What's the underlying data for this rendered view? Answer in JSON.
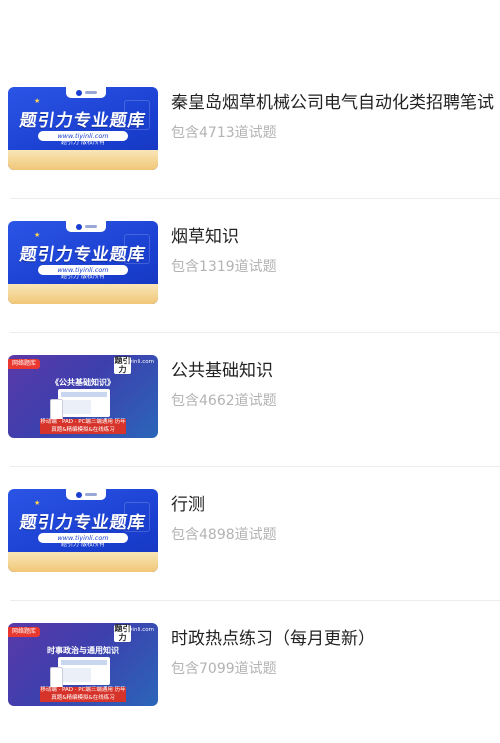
{
  "items": [
    {
      "title": "秦皇岛烟草机械公司电气自动化类招聘笔试",
      "count": "包含4713道试题",
      "thumb": {
        "style": "blue",
        "headline": "题引力专业题库",
        "url": "www.tiyinli.com",
        "footer": "题引力 版权所有"
      }
    },
    {
      "title": "烟草知识",
      "count": "包含1319道试题",
      "thumb": {
        "style": "blue",
        "headline": "题引力专业题库",
        "url": "www.tiyinli.com",
        "footer": "题引力 版权所有"
      }
    },
    {
      "title": "公共基础知识",
      "count": "包含4662道试题",
      "thumb": {
        "style": "purple",
        "ribbon": "网络题库",
        "brand": "题引力",
        "site": "tiyinli.com",
        "book_title": "《公共基础知识》",
        "note": "移动端 · PAD · PC端三端通用 历年真题&精编模拟&在线练习"
      }
    },
    {
      "title": "行测",
      "count": "包含4898道试题",
      "thumb": {
        "style": "blue",
        "headline": "题引力专业题库",
        "url": "www.tiyinli.com",
        "footer": "题引力 版权所有"
      }
    },
    {
      "title": "时政热点练习（每月更新）",
      "count": "包含7099道试题",
      "thumb": {
        "style": "purple",
        "ribbon": "网络题库",
        "brand": "题引力",
        "site": "tiyinli.com",
        "book_title": "时事政治与通用知识",
        "note": "移动端 · PAD · PC端三端通用 历年真题&精编模拟&在线练习"
      }
    }
  ]
}
